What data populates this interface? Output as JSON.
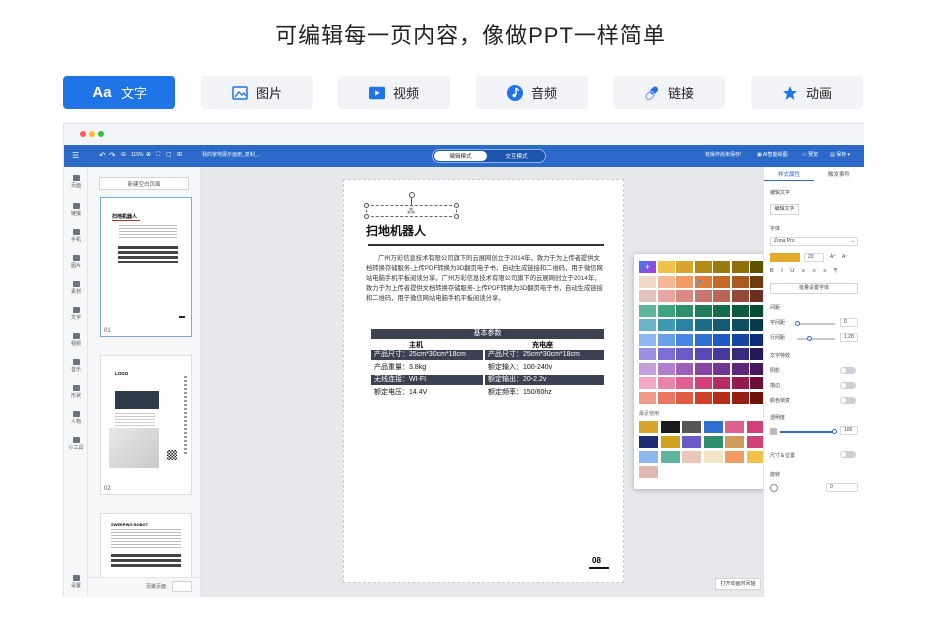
{
  "hero": {
    "title": "可编辑每一页内容，像做PPT一样简单"
  },
  "tabs": [
    {
      "label": "文字",
      "icon": "Aa",
      "icon_name": "text-aa-icon",
      "active": true
    },
    {
      "label": "图片",
      "icon_name": "image-icon",
      "active": false
    },
    {
      "label": "视频",
      "icon_name": "video-play-icon",
      "active": false
    },
    {
      "label": "音频",
      "icon_name": "music-note-icon",
      "active": false
    },
    {
      "label": "链接",
      "icon_name": "link-icon",
      "active": false
    },
    {
      "label": "动画",
      "icon_name": "star-icon",
      "active": false
    }
  ],
  "colors": {
    "accent": "#1f74e8",
    "toolbar": "#2c6ac9",
    "tab_bg": "#f2f3f7"
  },
  "editor": {
    "toolbar": {
      "zoom": "115%",
      "doc_title": "我的家电展示画册_复制_...",
      "mode_edit": "编辑模式",
      "mode_interact": "交互模式",
      "unsaved": "有操作尚未保存!",
      "ai_draw": "AI智能绘图",
      "preview": "预览",
      "save": "保存"
    },
    "left_nav": [
      "页面",
      "链接",
      "手机",
      "图片",
      "素材",
      "文字",
      "视频",
      "音乐",
      "形状",
      "人物",
      "小工具",
      "设置"
    ],
    "thumbs": {
      "new_page": "新建空白页面",
      "pages": [
        {
          "num": "01",
          "title": "扫地机器人"
        },
        {
          "num": "02",
          "title": "LOGO"
        },
        {
          "num": "",
          "title": "SWEEPING ROBOT"
        }
      ],
      "jump_label": "页跳页面"
    },
    "page": {
      "title": "扫地机器人",
      "body": "广州万彩信息技术有限公司旗下的云展网创立于2014年，致力于为上传者提供文档转换存储服务-上传PDF转换为3D翻页电子书，自动生成链接和二维码，用于微信网站电脑手机平板阅读分享。广州万彩信息技术有限公司旗下的云展网创立于2014年，致力于为上传者提供文档转换存储服务-上传PDF转换为3D翻页电子书，自动生成链接和二维码，用于微信网站电脑手机平板阅读分享。",
      "params_header": "基本参数",
      "col_a": "主机",
      "col_b": "充电座",
      "rows": [
        [
          "产品尺寸：25cm*30cm*18cm",
          "产品尺寸：25cm*30cm*18cm",
          true
        ],
        [
          "产品重量：3.8kg",
          "额定输入：100-240v",
          false
        ],
        [
          "无线连接：WI-FI",
          "额定输出：20-2.2v",
          true
        ],
        [
          "额定电压：14.4V",
          "额定频率：150/60hz",
          false
        ]
      ],
      "page_num": "08"
    },
    "open_anim": "打开动画时间轴",
    "panel": {
      "tab_style": "样式属性",
      "tab_event": "触发事件",
      "edit_text": "编辑文字",
      "edit_text_btn": "编辑文字",
      "font_label": "字体",
      "font_value": "Zona Pro",
      "font_size": "20",
      "batch_font": "批量设置字体",
      "spacing": "间距",
      "letter": "字间距",
      "letter_val": "0",
      "line": "行间距",
      "line_val": "1.28",
      "effects": "文字特效",
      "shadow": "阴影",
      "stroke": "描边",
      "gradient": "颜色渐变",
      "opacity": "透明度",
      "opacity_val": "100",
      "size_pos": "尺寸＆位置",
      "rotate": "旋转",
      "rotate_val": "0"
    },
    "palette": {
      "recent_label": "最近使用",
      "rows": [
        [
          "#f5f5f5",
          "#f0c24a",
          "#d9a52e",
          "#b58a16",
          "#9b7b0e",
          "#8d6e0b",
          "#5f5200"
        ],
        [
          "#f2d8c6",
          "#f5b896",
          "#f09c64",
          "#e07c3c",
          "#c46a28",
          "#a85a1f",
          "#6e3a0f"
        ],
        [
          "#e3c3bf",
          "#e8a6a1",
          "#d98a83",
          "#c9776f",
          "#b96558",
          "#944837",
          "#6b2f21"
        ],
        [
          "#5fb59b",
          "#3ca582",
          "#2e8f6c",
          "#1f7d5c",
          "#146b4d",
          "#0e5a3f",
          "#074a33"
        ],
        [
          "#6bb1c7",
          "#3c9ab5",
          "#2783a0",
          "#1c6e88",
          "#145a73",
          "#0f4d63",
          "#073a4b"
        ],
        [
          "#8fb7ef",
          "#6aa0ea",
          "#4685e0",
          "#2f6fd4",
          "#205ac1",
          "#1746a0",
          "#0b2e73"
        ],
        [
          "#9a8ee0",
          "#7d6fd5",
          "#6a5bc9",
          "#5747b7",
          "#46389c",
          "#372b80",
          "#251b5a"
        ],
        [
          "#c4a0d9",
          "#b17ecb",
          "#9c5fb8",
          "#8845a6",
          "#733592",
          "#5f277a",
          "#45195a"
        ],
        [
          "#f2a8c4",
          "#ea83a9",
          "#de6090",
          "#d04079",
          "#b62a63",
          "#951b4e",
          "#6a0f36"
        ],
        [
          "#f09a8c",
          "#ea7764",
          "#e05a44",
          "#d33f2a",
          "#b72d1b",
          "#962012",
          "#6b1308"
        ]
      ],
      "recent": [
        [
          "#d9a52e",
          "#1a1a1a",
          "#555555",
          "#2f6fd4",
          "#de6090",
          "#d04079"
        ],
        [
          "#1f2b73",
          "#cfa11c",
          "#6a5bc9",
          "#2e8f6c",
          "#cf9a5a",
          "#d04079"
        ],
        [
          "#8fb7ef",
          "#5fb59b",
          "#e8c7b6",
          "#f2e6c9",
          "#f09c64",
          "#f0c24a"
        ],
        [
          "#e0b9b1"
        ]
      ]
    }
  }
}
